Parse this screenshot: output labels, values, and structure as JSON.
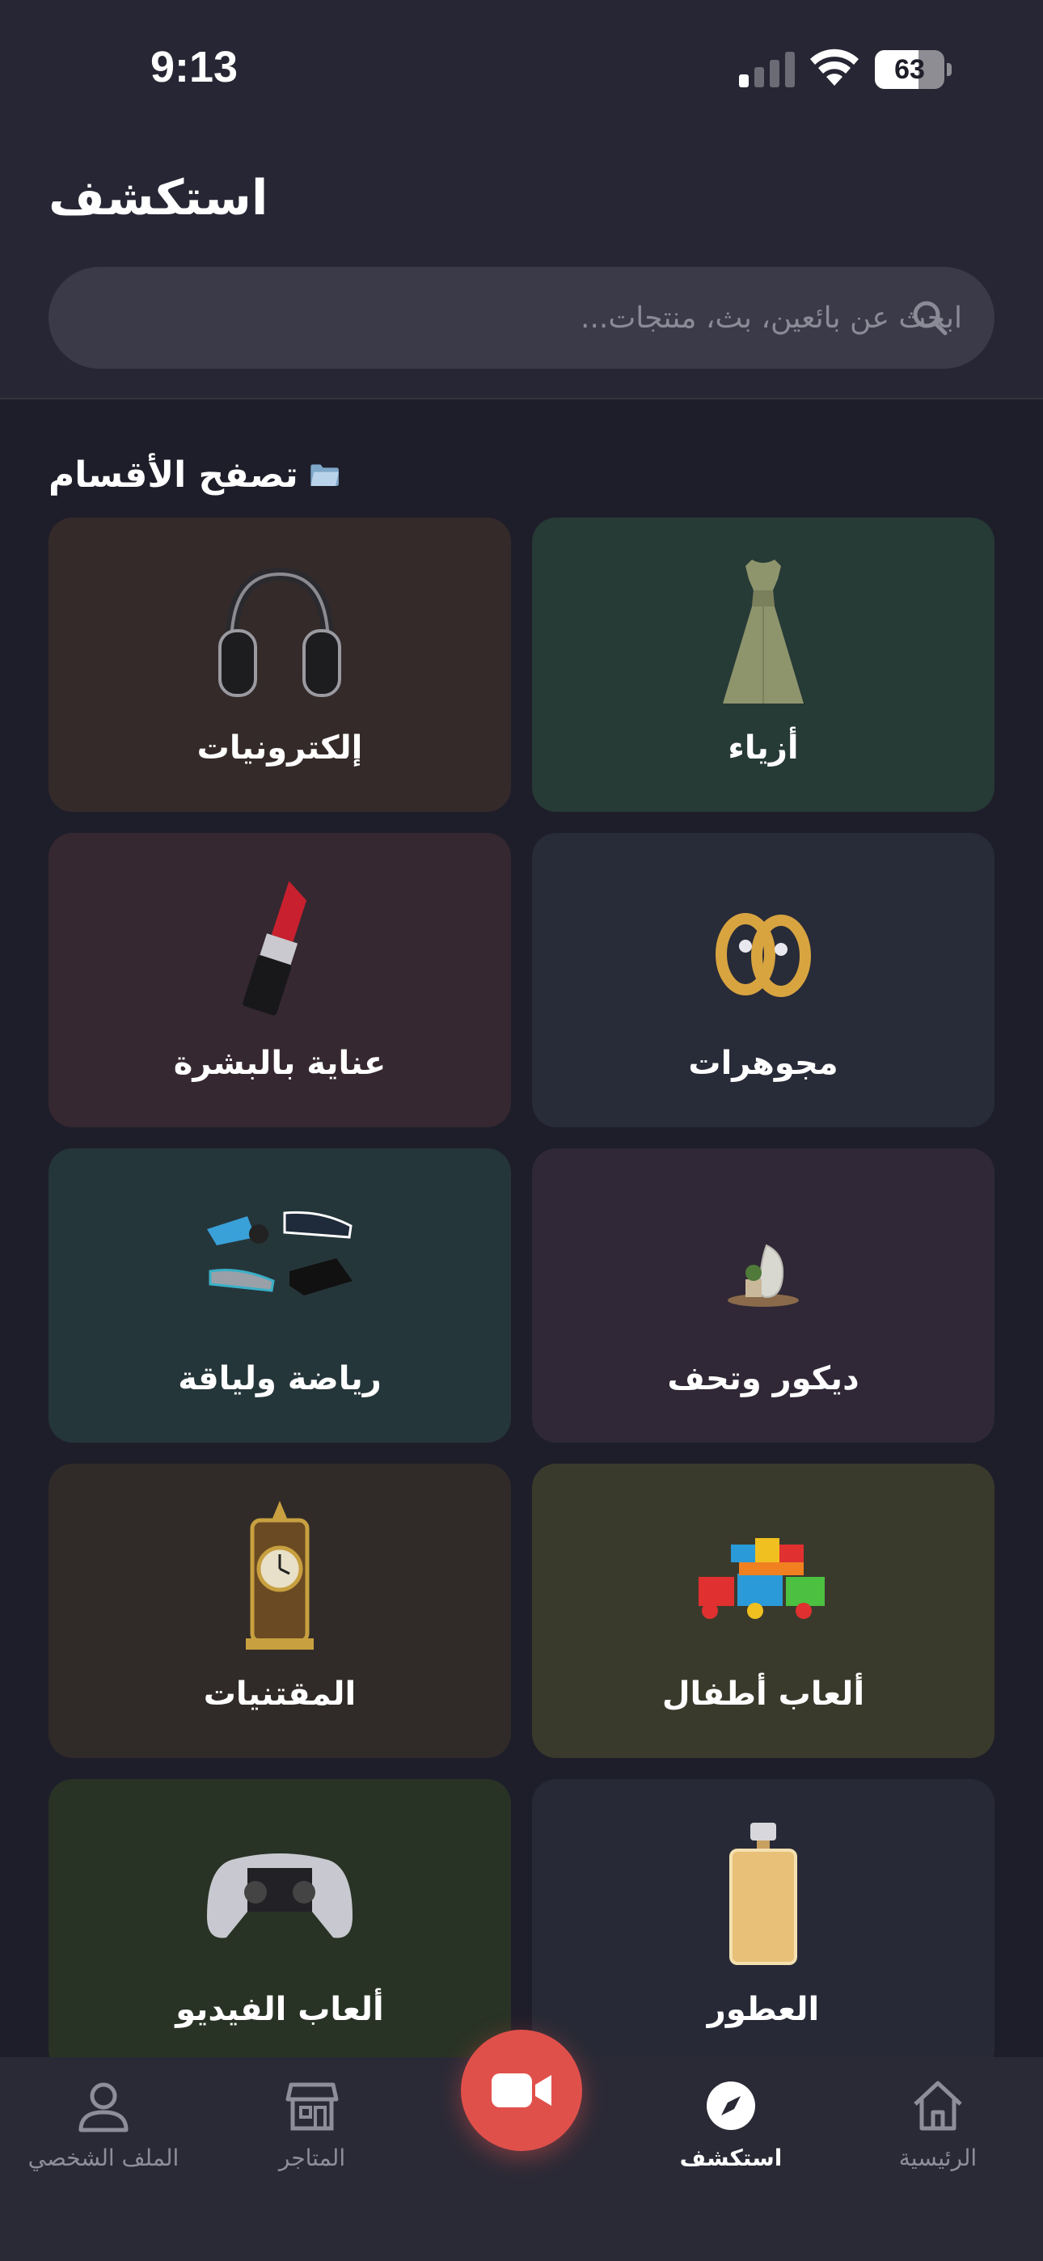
{
  "status_bar": {
    "time": "9:13",
    "battery": "63",
    "battery_level": 0.63
  },
  "header": {
    "title": "استكشف",
    "search_placeholder": "ابحث عن بائعين، بث، منتجات..."
  },
  "section": {
    "title": "تصفح الأقسام"
  },
  "categories": [
    {
      "label": "أزياء",
      "icon": "dress-icon",
      "color": "#263a36"
    },
    {
      "label": "إلكترونيات",
      "icon": "headphones-icon",
      "color": "#352a2a"
    },
    {
      "label": "مجوهرات",
      "icon": "rings-icon",
      "color": "#282b38"
    },
    {
      "label": "عناية بالبشرة",
      "icon": "lipstick-icon",
      "color": "#362830"
    },
    {
      "label": "ديكور وتحف",
      "icon": "decor-icon",
      "color": "#302836"
    },
    {
      "label": "رياضة ولياقة",
      "icon": "sneakers-icon",
      "color": "#25363a"
    },
    {
      "label": "ألعاب أطفال",
      "icon": "toy-train-icon",
      "color": "#3a3a2c"
    },
    {
      "label": "المقتنيات",
      "icon": "antique-clock-icon",
      "color": "#302b28"
    },
    {
      "label": "العطور",
      "icon": "perfume-icon",
      "color": "#272a36"
    },
    {
      "label": "ألعاب الفيديو",
      "icon": "gamepad-icon",
      "color": "#283325"
    }
  ],
  "bottom_nav": {
    "home": "الرئيسية",
    "explore": "استكشف",
    "stores": "المتاجر",
    "profile": "الملف الشخصي",
    "active": "explore"
  },
  "colors": {
    "background": "#1e1e2a",
    "header": "#262634",
    "accent": "#e0504b",
    "nav_inactive": "#8e8e9a"
  }
}
